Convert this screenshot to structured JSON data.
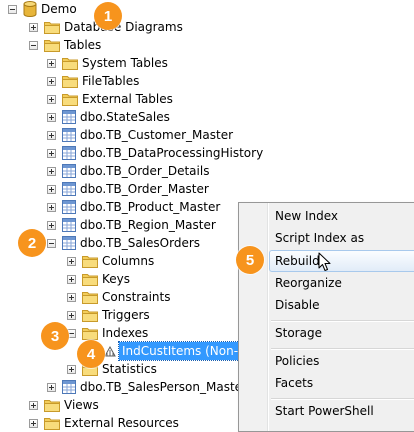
{
  "tree": {
    "root": "Demo",
    "database_diagrams": "Database Diagrams",
    "tables": "Tables",
    "system_tables": "System Tables",
    "file_tables": "FileTables",
    "external_tables": "External Tables",
    "t_state_sales": "dbo.StateSales",
    "t_customer_master": "dbo.TB_Customer_Master",
    "t_dataprocessing_history": "dbo.TB_DataProcessingHistory",
    "t_order_details": "dbo.TB_Order_Details",
    "t_order_master": "dbo.TB_Order_Master",
    "t_product_master": "dbo.TB_Product_Master",
    "t_region_master": "dbo.TB_Region_Master",
    "t_sales_orders": "dbo.TB_SalesOrders",
    "columns": "Columns",
    "keys": "Keys",
    "constraints": "Constraints",
    "triggers": "Triggers",
    "indexes": "Indexes",
    "index_item": "IndCustItems (Non-Ur",
    "statistics": "Statistics",
    "t_salesperson_master": "dbo.TB_SalesPerson_Master",
    "views": "Views",
    "external_resources": "External Resources"
  },
  "context_menu": {
    "new_index": "New Index",
    "script_index_as": "Script Index as",
    "rebuild": "Rebuild",
    "reorganize": "Reorganize",
    "disable": "Disable",
    "storage": "Storage",
    "policies": "Policies",
    "facets": "Facets",
    "start_powershell": "Start PowerShell"
  },
  "callouts": {
    "c1": "1",
    "c2": "2",
    "c3": "3",
    "c4": "4",
    "c5": "5"
  },
  "colors": {
    "callout": "#f7941d",
    "selection": "#3399ff",
    "menu_hover": "#e1ecf8",
    "folder": "#f0c44a"
  },
  "icons": {
    "database": "database-icon",
    "folder": "folder-icon",
    "table": "table-icon",
    "index": "index-icon",
    "cursor": "mouse-pointer-icon"
  }
}
